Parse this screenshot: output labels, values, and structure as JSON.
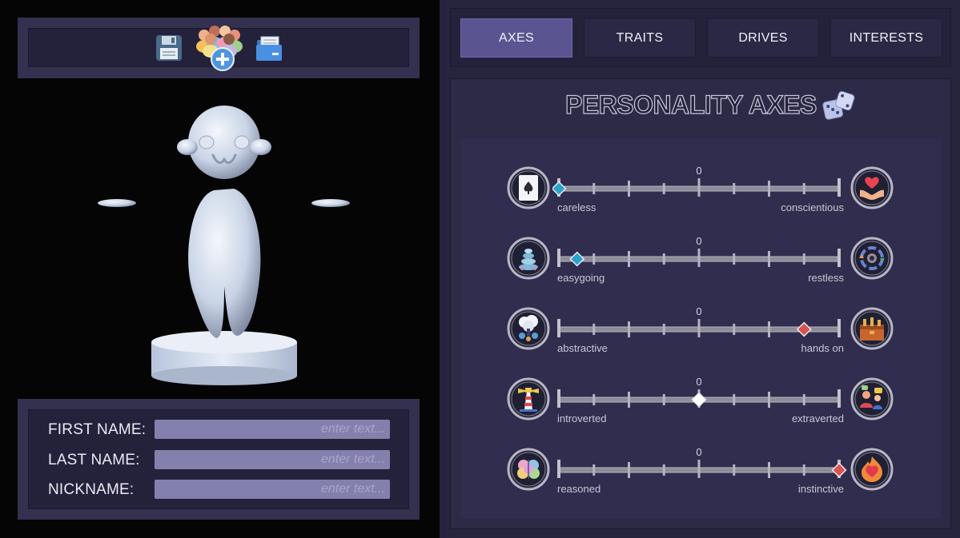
{
  "toolbar": {
    "save_icon": "floppy-disk-icon",
    "new_icon": "add-crowd-icon",
    "load_icon": "folder-icon"
  },
  "form": {
    "first_name_label": "FIRST NAME:",
    "last_name_label": "LAST NAME:",
    "nickname_label": "NICKNAME:",
    "first_name_value": "",
    "last_name_value": "",
    "nickname_value": "",
    "placeholder": "enter text..."
  },
  "tabs": [
    {
      "label": "AXES",
      "active": true
    },
    {
      "label": "TRAITS",
      "active": false
    },
    {
      "label": "DRIVES",
      "active": false
    },
    {
      "label": "INTERESTS",
      "active": false
    }
  ],
  "axes_panel": {
    "title": "PERSONALITY AXES",
    "dice_icon": "dice-icon",
    "center_mark": "0",
    "axes": [
      {
        "left_label": "careless",
        "right_label": "conscientious",
        "value": -1.0,
        "marker_color": "#2ba3c9",
        "left_icon": "spade-card-icon",
        "right_icon": "heart-hands-icon"
      },
      {
        "left_label": "easygoing",
        "right_label": "restless",
        "value": -0.87,
        "marker_color": "#2ba3c9",
        "left_icon": "stacked-stones-icon",
        "right_icon": "gear-cycle-icon"
      },
      {
        "left_label": "abstractive",
        "right_label": "hands on",
        "value": 0.75,
        "marker_color": "#d9534f",
        "left_icon": "thought-tree-icon",
        "right_icon": "toolbox-icon"
      },
      {
        "left_label": "introverted",
        "right_label": "extraverted",
        "value": 0.0,
        "marker_color": "#ffffff",
        "left_icon": "lighthouse-icon",
        "right_icon": "people-talk-icon"
      },
      {
        "left_label": "reasoned",
        "right_label": "instinctive",
        "value": 1.0,
        "marker_color": "#d9534f",
        "left_icon": "brain-icon",
        "right_icon": "fire-heart-icon"
      }
    ]
  }
}
